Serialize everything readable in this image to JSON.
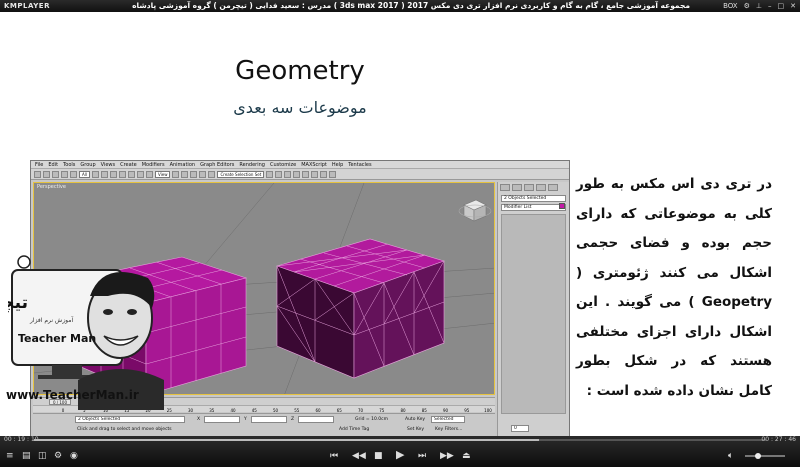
{
  "titlebar": {
    "logo": "KMPLAYER",
    "caption": "مجموعه آموزشی جامع ، گام به گام و کاربردی نرم افزار تری دی مکس 2017 ( 3ds max 2017 ) مدرس : سعید فدایی ( تیچرمن ) گروه آموزشی پادشاه گرافیست ها",
    "box_label": "BOX",
    "settings_icon": "gear-icon",
    "pin_icon": "pin-icon",
    "minimize_icon": "minimize-icon",
    "maximize_icon": "maximize-icon",
    "close_icon": "close-icon"
  },
  "slide": {
    "title": "Geometry",
    "subtitle": "موضوعات سه بعدی",
    "body": "در تری دی اس مکس به طور کلی به موضوعاتی که دارای حجم بوده و فضای حجمی اشکال می کنند ژئومتری ( Geopetry ) می گویند . این اشکال دارای اجزای مختلفی هستند که در شکل بطور کامل نشان داده شده است :"
  },
  "max": {
    "menus": [
      "File",
      "Edit",
      "Tools",
      "Group",
      "Views",
      "Create",
      "Modifiers",
      "Animation",
      "Graph Editors",
      "Rendering",
      "Customize",
      "MAXScript",
      "Help",
      "Tentacles"
    ],
    "toolbar_filter": "All",
    "toolbar_coord": "View",
    "toolbar_selset": "Create Selection Set",
    "viewport_label": "Perspective",
    "cmd_objects_selected": "2 Objects Selected",
    "cmd_modifier_list": "Modifier List",
    "object_color": "#c21aa5",
    "timeline_frame": "0 / 100",
    "timeline_ticks": [
      "0",
      "5",
      "10",
      "15",
      "20",
      "25",
      "30",
      "35",
      "40",
      "45",
      "50",
      "55",
      "60",
      "65",
      "70",
      "75",
      "80",
      "85",
      "90",
      "95",
      "100"
    ],
    "status_selected": "2 Objects Selected",
    "status_prompt": "Click and drag to select and move objects",
    "axis_x": "X",
    "axis_y": "Y",
    "axis_z": "Z",
    "grid": "Grid = 10.0cm",
    "auto_key": "Auto Key",
    "set_key": "Set Key",
    "selected_dropdown": "Selected",
    "key_filters": "Key Filters...",
    "add_time_tag": "Add Time Tag",
    "frame_field": "0"
  },
  "logo": {
    "persian": "تیچرمن",
    "sub": "آموزش نرم افزار",
    "name": "Teacher Man",
    "url": "www.TeacherMan.ir"
  },
  "player": {
    "time_elapsed": "00 : 19 : 10",
    "time_total": "00 : 27 : 46",
    "progress": 0.69,
    "volume": 0.25
  }
}
